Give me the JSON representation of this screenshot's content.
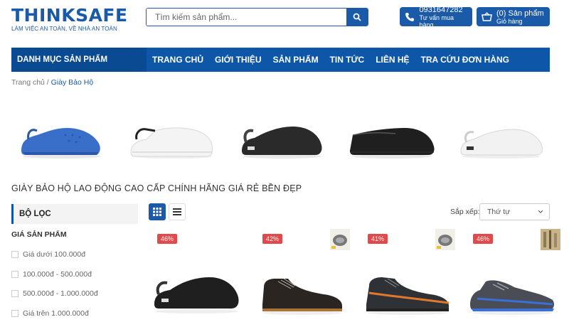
{
  "header": {
    "brand": "THINKSAFE",
    "tagline": "LÀM VIỆC AN TOÀN, VỀ NHÀ AN TOÀN",
    "search_placeholder": "Tìm kiếm sản phẩm...",
    "phone": "0931647282",
    "phone_sub": "Tư vấn mua hàng",
    "cart": "(0) Sản phẩm",
    "cart_sub": "Giỏ hàng"
  },
  "nav": {
    "category": "DANH MỤC SẢN PHẨM",
    "items": [
      "TRANG CHỦ",
      "GIỚI THIỆU",
      "SẢN PHẨM",
      "TIN TỨC",
      "LIÊN HỆ",
      "TRA CỨU ĐƠN HÀNG"
    ]
  },
  "breadcrumb": {
    "home": "Trang chủ",
    "sep": " / ",
    "current": "Giày Bảo Hộ"
  },
  "section_title": "GIÀY BẢO HỘ LAO ĐỘNG CAO CẤP CHÍNH HÃNG GIÁ RẺ BỀN ĐẸP",
  "sidebar": {
    "filter_title": "BỘ LỌC",
    "price_title": "GIÁ SẢN PHẨM",
    "options": [
      "Giá dưới 100.000đ",
      "100.000đ - 500.000đ",
      "500.000đ - 1.000.000đ",
      "Giá trên 1.000.000đ"
    ]
  },
  "toolbar": {
    "sort_label": "Sắp xếp:",
    "sort_value": "Thứ tự"
  },
  "products": [
    {
      "discount": "46%"
    },
    {
      "discount": "42%"
    },
    {
      "discount": "41%"
    },
    {
      "discount": "46%"
    }
  ],
  "colors": {
    "brand": "#1a5aa8",
    "nav": "#0e57a8",
    "badge": "#e14a4a"
  }
}
